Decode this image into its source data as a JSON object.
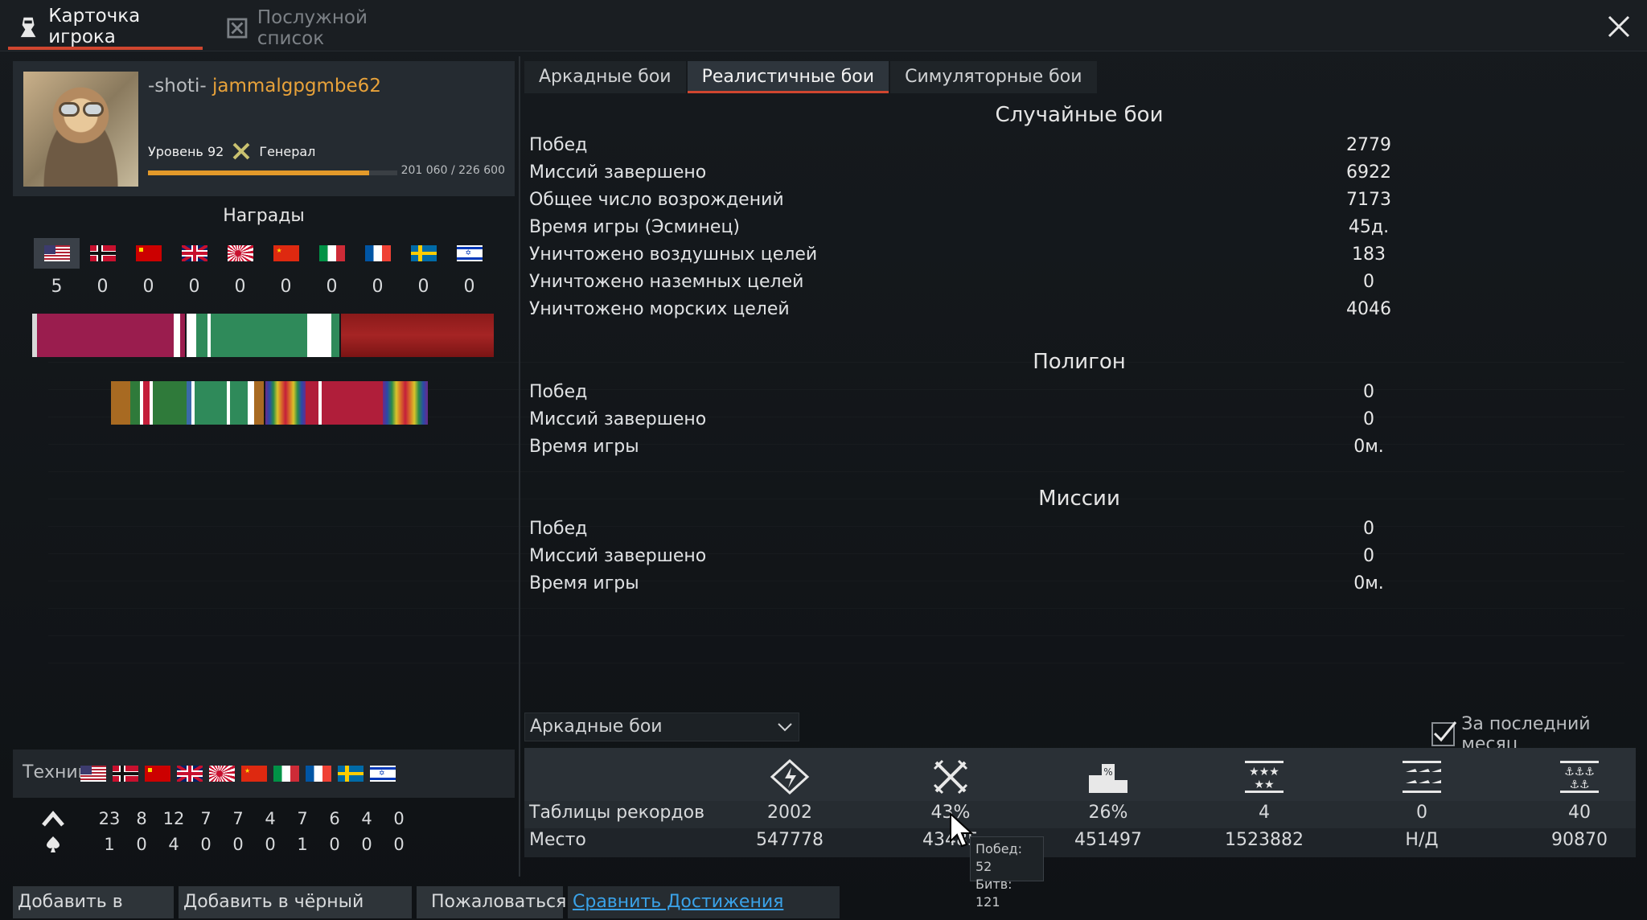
{
  "top_tabs": {
    "profile": "Карточка игрока",
    "service": "Послужной список"
  },
  "player": {
    "clan": "-shoti-",
    "nick": "jammalgpgmbe62",
    "level": "Уровень 92",
    "rank": "Генерал",
    "xp": "201 060 / 226 600",
    "xp_progress": 0.887
  },
  "awards": {
    "title": "Награды",
    "nations": [
      "usa",
      "germany",
      "ussr",
      "britain",
      "japan",
      "china",
      "italy",
      "france",
      "sweden",
      "israel"
    ],
    "counts": [
      "5",
      "0",
      "0",
      "0",
      "0",
      "0",
      "0",
      "0",
      "0",
      "0"
    ]
  },
  "vehicles": {
    "label": "Техника",
    "row1": [
      "23",
      "8",
      "12",
      "7",
      "7",
      "4",
      "7",
      "6",
      "4",
      "0"
    ],
    "row2": [
      "1",
      "0",
      "4",
      "0",
      "0",
      "0",
      "1",
      "0",
      "0",
      "0"
    ]
  },
  "mode_tabs": [
    "Аркадные бои",
    "Реалистичные бои",
    "Симуляторные бои"
  ],
  "random_battles": {
    "title": "Случайные бои",
    "rows": [
      {
        "label": "Побед",
        "value": "2779"
      },
      {
        "label": "Миссий завершено",
        "value": "6922"
      },
      {
        "label": "Общее число возрождений",
        "value": "7173"
      },
      {
        "label": "Время игры (Эсминец)",
        "value": "45д."
      },
      {
        "label": "Уничтожено воздушных целей",
        "value": "183"
      },
      {
        "label": "Уничтожено наземных целей",
        "value": "0"
      },
      {
        "label": "Уничтожено морских целей",
        "value": "4046"
      }
    ]
  },
  "polygon": {
    "title": "Полигон",
    "rows": [
      {
        "label": "Побед",
        "value": "0"
      },
      {
        "label": "Миссий завершено",
        "value": "0"
      },
      {
        "label": "Время игры",
        "value": "0м."
      }
    ]
  },
  "missions": {
    "title": "Миссии",
    "rows": [
      {
        "label": "Побед",
        "value": "0"
      },
      {
        "label": "Миссий завершено",
        "value": "0"
      },
      {
        "label": "Время игры",
        "value": "0м."
      }
    ]
  },
  "records": {
    "mode_select": "Аркадные бои",
    "last_month": "За последний месяц",
    "last_month_checked": true,
    "row_labels": {
      "records": "Таблицы рекордов",
      "place": "Место"
    },
    "records_values": [
      "2002",
      "43%",
      "26%",
      "4",
      "0",
      "40"
    ],
    "place_values": [
      "547778",
      "43485",
      "451497",
      "1523882",
      "Н/Д",
      "90870"
    ]
  },
  "tooltip": {
    "wins": "Побед: 52",
    "battles": "Битв: 121"
  },
  "buttons": {
    "add_friend": "Добавить в друзья",
    "blacklist": "Добавить в чёрный список",
    "complain": "Пожаловаться",
    "compare": "Сравнить Достижения Gaijin.Net"
  }
}
